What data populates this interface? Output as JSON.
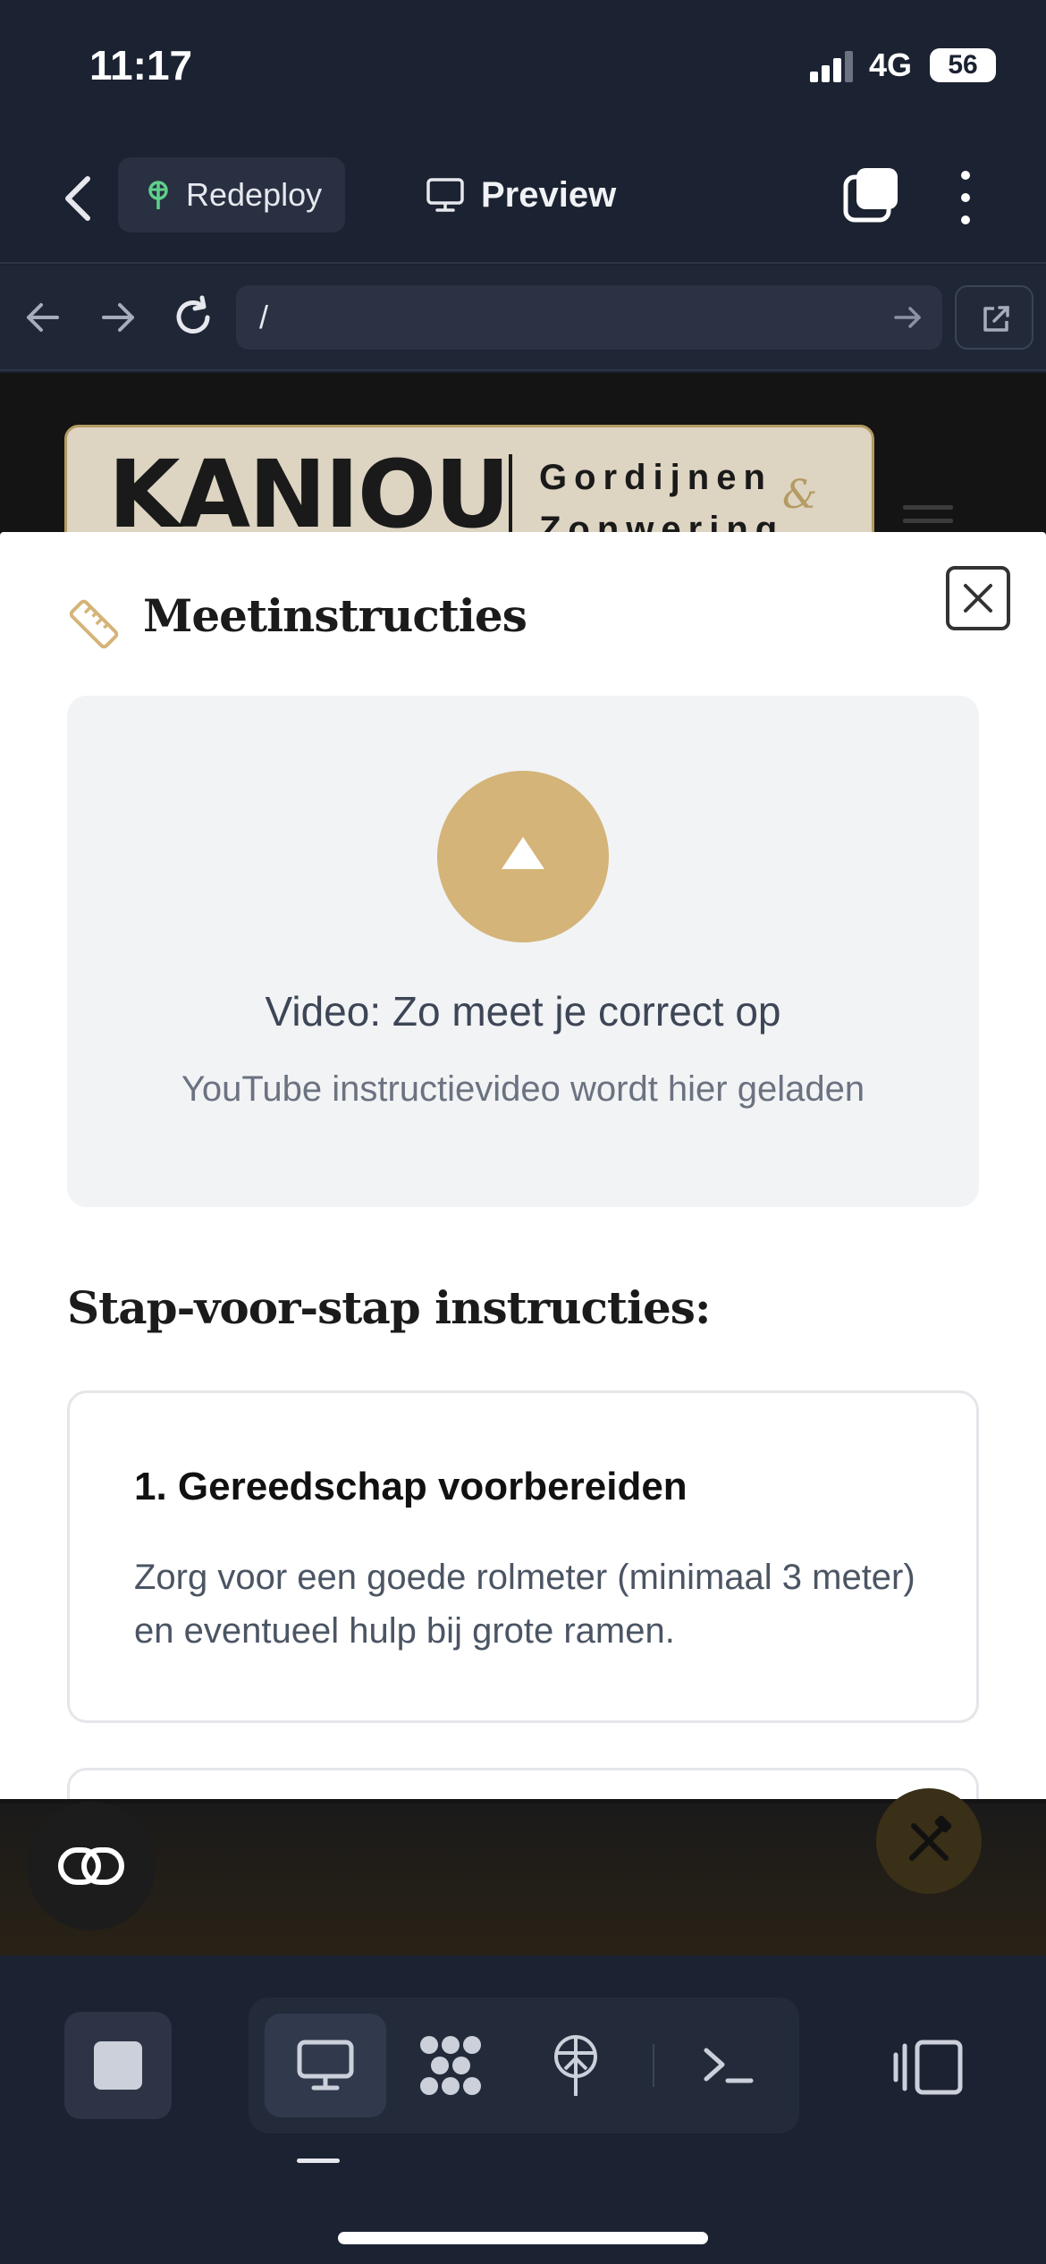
{
  "status_bar": {
    "time": "11:17",
    "network": "4G",
    "battery": "56"
  },
  "header": {
    "redeploy_label": "Redeploy",
    "preview_label": "Preview"
  },
  "url_bar": {
    "url": "/"
  },
  "site": {
    "logo_main": "KANIOU",
    "logo_sub_line1": "Gordijnen",
    "logo_sub_line2": "Zonwering",
    "logo_amp": "&"
  },
  "modal": {
    "title": "Meetinstructies",
    "video": {
      "title": "Video: Zo meet je correct op",
      "subtitle": "YouTube instructievideo wordt hier geladen"
    },
    "steps_heading": "Stap-voor-stap instructies:",
    "steps": [
      {
        "title": "1. Gereedschap voorbereiden",
        "body": "Zorg voor een goede rolmeter (minimaal 3 meter) en eventueel hulp bij grote ramen."
      }
    ]
  },
  "colors": {
    "accent_gold": "#d4b478",
    "app_bg": "#1b2231",
    "modal_bg": "#ffffff",
    "video_bg": "#f2f3f5"
  },
  "icons": [
    "back-icon",
    "redeploy-icon",
    "monitor-icon",
    "tabs-icon",
    "more-icon",
    "nav-back-icon",
    "nav-forward-icon",
    "reload-icon",
    "go-arrow-icon",
    "external-link-icon",
    "ruler-icon",
    "close-icon",
    "play-icon",
    "link-icon",
    "tools-icon",
    "stop-icon",
    "desktop-icon",
    "apps-icon",
    "deploy-icon",
    "terminal-icon",
    "sidebar-icon"
  ]
}
